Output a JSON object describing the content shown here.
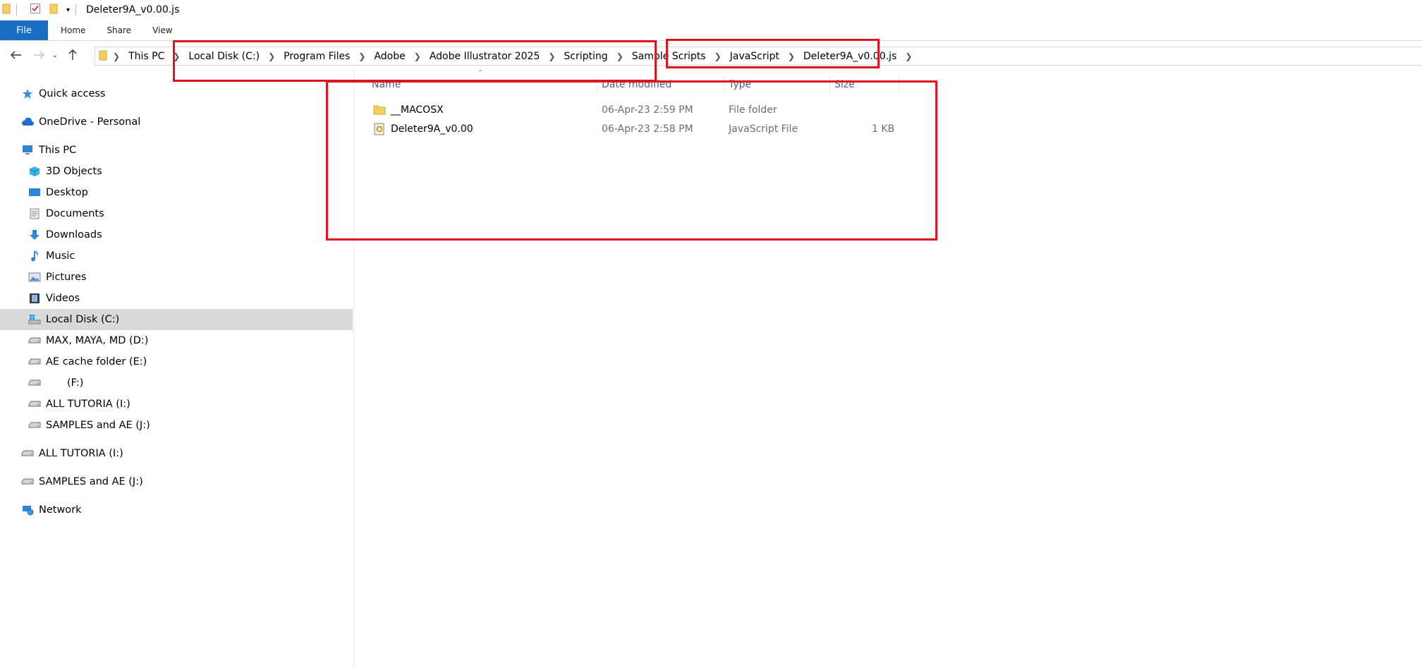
{
  "window": {
    "title": "Deleter9A_v0.00.js"
  },
  "ribbon": {
    "tabs": [
      "File",
      "Home",
      "Share",
      "View"
    ]
  },
  "address": {
    "crumbs": [
      "This PC",
      "Local Disk (C:)",
      "Program Files",
      "Adobe",
      "Adobe Illustrator 2025",
      "Scripting",
      "Sample Scripts",
      "JavaScript",
      "Deleter9A_v0.00.js"
    ]
  },
  "sidebar": {
    "items": [
      {
        "label": "Quick access",
        "icon": "star-icon"
      },
      {
        "label": "OneDrive - Personal",
        "icon": "cloud-icon"
      },
      {
        "label": "This PC",
        "icon": "computer-icon"
      },
      {
        "label": "3D Objects",
        "icon": "cube-icon"
      },
      {
        "label": "Desktop",
        "icon": "desktop-icon"
      },
      {
        "label": "Documents",
        "icon": "document-icon"
      },
      {
        "label": "Downloads",
        "icon": "download-arrow-icon"
      },
      {
        "label": "Music",
        "icon": "music-note-icon"
      },
      {
        "label": "Pictures",
        "icon": "picture-icon"
      },
      {
        "label": "Videos",
        "icon": "film-icon"
      },
      {
        "label": "Local Disk (C:)",
        "icon": "windows-drive-icon"
      },
      {
        "label": "MAX, MAYA, MD (D:)",
        "icon": "drive-icon"
      },
      {
        "label": "AE cache folder (E:)",
        "icon": "drive-icon"
      },
      {
        "label": "(F:)",
        "icon": "drive-icon"
      },
      {
        "label": "ALL TUTORIA (I:)",
        "icon": "drive-icon"
      },
      {
        "label": "SAMPLES and AE (J:)",
        "icon": "drive-icon"
      },
      {
        "label": "ALL TUTORIA (I:)",
        "icon": "drive-icon"
      },
      {
        "label": "SAMPLES and AE (J:)",
        "icon": "drive-icon"
      },
      {
        "label": "Network",
        "icon": "network-icon"
      }
    ]
  },
  "filelist": {
    "columns": [
      "Name",
      "Date modified",
      "Type",
      "Size"
    ],
    "rows": [
      {
        "name": "__MACOSX",
        "date": "06-Apr-23 2:59 PM",
        "type": "File folder",
        "size": "",
        "icon": "folder-icon"
      },
      {
        "name": "Deleter9A_v0.00",
        "date": "06-Apr-23 2:58 PM",
        "type": "JavaScript File",
        "size": "1 KB",
        "icon": "script-file-icon"
      }
    ]
  },
  "colors": {
    "accent": "#1a6fc4",
    "annotation": "#e0141e",
    "selected": "#d9d9d9",
    "folder": "#f3cf62"
  }
}
